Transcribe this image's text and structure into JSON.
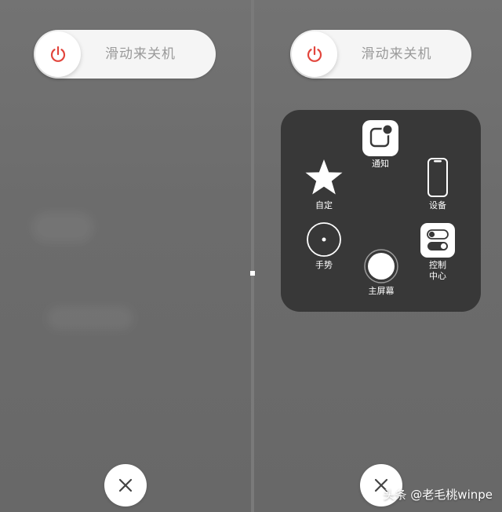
{
  "left_screen": {
    "slider_label": "滑动来关机"
  },
  "right_screen": {
    "slider_label": "滑动来关机"
  },
  "assistive_menu": {
    "notification": "通知",
    "custom": "自定",
    "device": "设备",
    "gestures": "手势",
    "control_center_line1": "控制",
    "control_center_line2": "中心",
    "home": "主屏幕"
  },
  "watermark": "头条 @老毛桃winpe",
  "icons": {
    "power": "power-icon",
    "close": "close-icon",
    "notification": "notification-center-icon",
    "custom": "star-icon",
    "device": "iphone-device-icon",
    "gestures": "gesture-circle-icon",
    "control_center": "toggle-switches-icon",
    "home": "home-button-icon"
  },
  "colors": {
    "power_red": "#e2453c",
    "menu_bg": "#383838"
  }
}
